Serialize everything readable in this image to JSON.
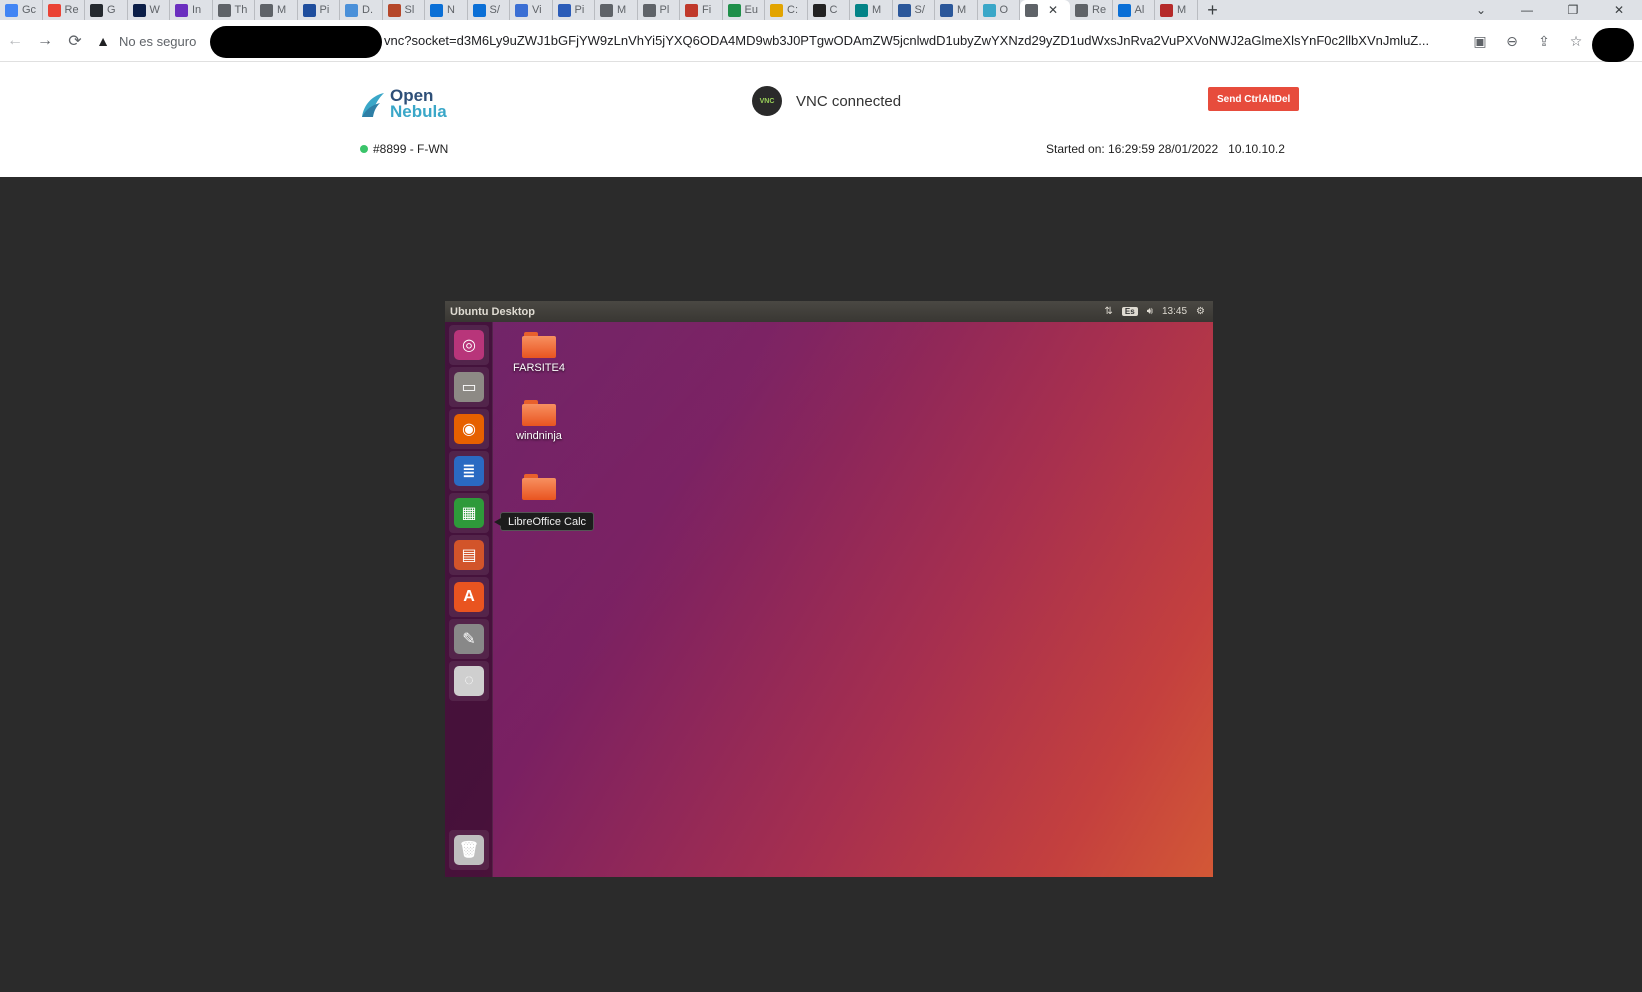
{
  "browser": {
    "tabs": [
      {
        "icon": "google-sheets-icon",
        "label": "Gc",
        "color": "#4285f4"
      },
      {
        "icon": "gmail-icon",
        "label": "Re",
        "color": "#ea4335"
      },
      {
        "icon": "github-icon",
        "label": "G",
        "color": "#24292e"
      },
      {
        "icon": "w-icon",
        "label": "W",
        "color": "#0b1e47"
      },
      {
        "icon": "in-icon",
        "label": "In",
        "color": "#6b2fbf"
      },
      {
        "icon": "globe-icon",
        "label": "Th",
        "color": "#5f6368"
      },
      {
        "icon": "globe-icon",
        "label": "M",
        "color": "#5f6368"
      },
      {
        "icon": "h-icon",
        "label": "Pi",
        "color": "#1f4e9d"
      },
      {
        "icon": "s-icon",
        "label": "D.",
        "color": "#4a90d9"
      },
      {
        "icon": "bookmark-icon",
        "label": "Sl",
        "color": "#b5472a"
      },
      {
        "icon": "cloud-icon",
        "label": "N",
        "color": "#0a6fd6"
      },
      {
        "icon": "cloud-icon",
        "label": "S/",
        "color": "#0a6fd6"
      },
      {
        "icon": "lab-icon",
        "label": "Vi",
        "color": "#3b6fd4"
      },
      {
        "icon": "feather-icon",
        "label": "Pi",
        "color": "#2b5cb8"
      },
      {
        "icon": "globe-icon",
        "label": "M",
        "color": "#5f6368"
      },
      {
        "icon": "globe-icon",
        "label": "Pl",
        "color": "#5f6368"
      },
      {
        "icon": "chart-icon",
        "label": "Fi",
        "color": "#c0392b"
      },
      {
        "icon": "sigma-icon",
        "label": "Eu",
        "color": "#1f8f4a"
      },
      {
        "icon": "diamond-icon",
        "label": "C:",
        "color": "#e2a400"
      },
      {
        "icon": "diamond-icon",
        "label": "C",
        "color": "#222222"
      },
      {
        "icon": "sharepoint-icon",
        "label": "M",
        "color": "#038387"
      },
      {
        "icon": "word-icon",
        "label": "S/",
        "color": "#2b579a"
      },
      {
        "icon": "word-icon",
        "label": "M",
        "color": "#2b579a"
      },
      {
        "icon": "opennebula-icon",
        "label": "O",
        "color": "#3aa7c8"
      },
      {
        "icon": "globe-icon",
        "label": "",
        "color": "#5f6368",
        "active": true
      },
      {
        "icon": "globe-icon",
        "label": "Re",
        "color": "#5f6368"
      },
      {
        "icon": "cloud-icon",
        "label": "Al",
        "color": "#0a6fd6"
      },
      {
        "icon": "bug-icon",
        "label": "M",
        "color": "#b52a2a"
      }
    ],
    "address": {
      "security_label": "No es seguro",
      "url_visible": "vnc?socket=d3M6Ly9uZWJ1bGFjYW9zLnVhYi5jYXQ6ODA4MD9wb3J0PTgwODAmZW5jcnlwdD1ubyZwYXNzd29yZD1udWxsJnRva2VuPXVoNWJ2aGlmeXlsYnF0c2llbXVnJmluZ..."
    }
  },
  "opennebula": {
    "logo_line1": "Open",
    "logo_line2": "Nebula",
    "vnc_logo_text": "VNC",
    "vnc_status": "VNC connected",
    "send_ctrlaltdel": "Send CtrlAltDel",
    "vm_label": "#8899 - F-WN",
    "started_on": "Started on: 16:29:59 28/01/2022",
    "ip": "10.10.10.2"
  },
  "ubuntu": {
    "panel_title": "Ubuntu Desktop",
    "keyboard_layout": "Es",
    "clock": "13:45",
    "desktop_icons": [
      {
        "label": "FARSITE4"
      },
      {
        "label": "windninja"
      },
      {
        "label": ""
      }
    ],
    "launcher": [
      {
        "name": "ubuntu-dash-icon",
        "color": "#b8357a"
      },
      {
        "name": "files-icon",
        "color": "#8d8a85"
      },
      {
        "name": "firefox-icon",
        "color": "#e66000"
      },
      {
        "name": "libreoffice-writer-icon",
        "color": "#2a6ac2"
      },
      {
        "name": "libreoffice-calc-icon",
        "color": "#2e9a3a"
      },
      {
        "name": "libreoffice-impress-icon",
        "color": "#d2542a"
      },
      {
        "name": "ubuntu-software-icon",
        "color": "#e95420"
      },
      {
        "name": "system-settings-icon",
        "color": "#888888"
      },
      {
        "name": "dvd-icon",
        "color": "#cfcfcf"
      },
      {
        "name": "trash-icon",
        "color": "#bfbfbf"
      }
    ],
    "tooltip": "LibreOffice Calc"
  }
}
